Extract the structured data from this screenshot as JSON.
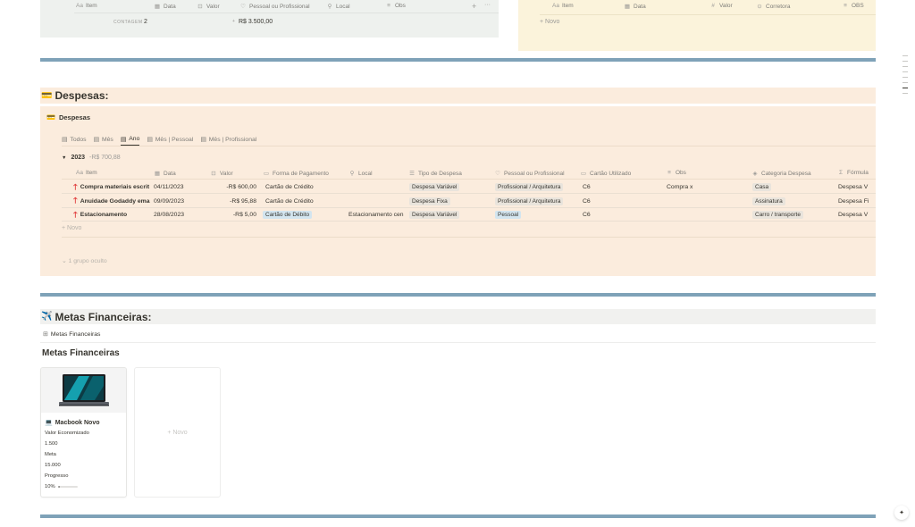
{
  "top_left_table": {
    "headers": [
      {
        "icon": "Aa",
        "label": "Item"
      },
      {
        "icon": "▦",
        "label": "Data"
      },
      {
        "icon": "⊡",
        "label": "Valor"
      },
      {
        "icon": "♡",
        "label": "Pessoal ou Profissional"
      },
      {
        "icon": "⚲",
        "label": "Local"
      },
      {
        "icon": "≡",
        "label": "Obs"
      }
    ],
    "add_symbol": "+",
    "more_symbol": "···",
    "count_label": "CONTAGEM",
    "count_value": "2",
    "sum_label": "+",
    "sum_value": "R$ 3.500,00"
  },
  "top_right_table": {
    "headers": [
      {
        "icon": "Aa",
        "label": "Item"
      },
      {
        "icon": "▦",
        "label": "Data"
      },
      {
        "icon": "#",
        "label": "Valor"
      },
      {
        "icon": "⊙",
        "label": "Corretora"
      },
      {
        "icon": "≡",
        "label": "OBS"
      }
    ],
    "new_label": "+ Novo"
  },
  "despesas_section": {
    "title_icon": "💳",
    "title": "Despesas:",
    "db_icon": "💳",
    "db_title": "Despesas",
    "tabs": [
      {
        "icon": "▤",
        "label": "Todos"
      },
      {
        "icon": "▤",
        "label": "Mês"
      },
      {
        "icon": "▤",
        "label": "Ano"
      },
      {
        "icon": "▤",
        "label": "Mês | Pessoal"
      },
      {
        "icon": "▤",
        "label": "Mês | Profissional"
      }
    ],
    "active_tab": "Ano",
    "group": {
      "toggle": "▼",
      "year": "2023",
      "total": "-R$ 700,88"
    },
    "headers": [
      {
        "icon": "Aa",
        "label": "Item"
      },
      {
        "icon": "▦",
        "label": "Data"
      },
      {
        "icon": "⊡",
        "label": "Valor"
      },
      {
        "icon": "▭",
        "label": "Forma de Pagamento"
      },
      {
        "icon": "⚲",
        "label": "Local"
      },
      {
        "icon": "☰",
        "label": "Tipo de Despesa"
      },
      {
        "icon": "♡",
        "label": "Pessoal ou Profissional"
      },
      {
        "icon": "▭",
        "label": "Cartão Utilizado"
      },
      {
        "icon": "≡",
        "label": "Obs"
      },
      {
        "icon": "◈",
        "label": "Categoria Despesa"
      },
      {
        "icon": "Σ",
        "label": "Fórmula"
      }
    ],
    "rows": [
      {
        "item": "Compra materiais escrit",
        "data": "04/11/2023",
        "valor": "-R$ 600,00",
        "forma": "Cartão de Crédito",
        "local": "",
        "tipo": "Despesa Variável",
        "pp": "Profissional / Arquitetura",
        "cartao": "C6",
        "obs": "Compra x",
        "categoria": "Casa",
        "formula": "Despesa V"
      },
      {
        "item": "Anuidade Godaddy ema",
        "data": "09/09/2023",
        "valor": "-R$ 95,88",
        "forma": "Cartão de Crédito",
        "local": "",
        "tipo": "Despesa Fixa",
        "pp": "Profissional / Arquitetura",
        "cartao": "C6",
        "obs": "",
        "categoria": "Assinatura",
        "formula": "Despesa Fi"
      },
      {
        "item": "Estacionamento",
        "data": "28/08/2023",
        "valor": "-R$ 5,00",
        "forma": "Cartão de Débito",
        "local": "Estacionamento cen",
        "tipo": "Despesa Variável",
        "pp": "Pessoal",
        "cartao": "C6",
        "obs": "",
        "categoria": "Carro / transporte",
        "formula": "Despesa V"
      }
    ],
    "new_label": "+ Novo",
    "hidden_groups": "1 grupo oculto"
  },
  "metas_section": {
    "title_icon": "✈️",
    "title": "Metas Financeiras:",
    "view_icon": "⊞",
    "view_label": "Metas Financeiras",
    "gallery_title": "Metas Financeiras",
    "card": {
      "name_icon": "💻",
      "name": "Macbook Novo",
      "prop1_label": "Valor Economizado",
      "prop1_value": "1.500",
      "prop2_label": "Meta",
      "prop2_value": "15.000",
      "prop3_label": "Progresso",
      "prop3_value": "10%",
      "progress": 0.1
    },
    "new_card_label": "+ Novo"
  },
  "colors": {
    "green_panel": "#eef1ee",
    "yellow_panel": "#fbf3db",
    "orange_panel": "#fbecdd",
    "blue_divider": "#7fa2b8"
  }
}
